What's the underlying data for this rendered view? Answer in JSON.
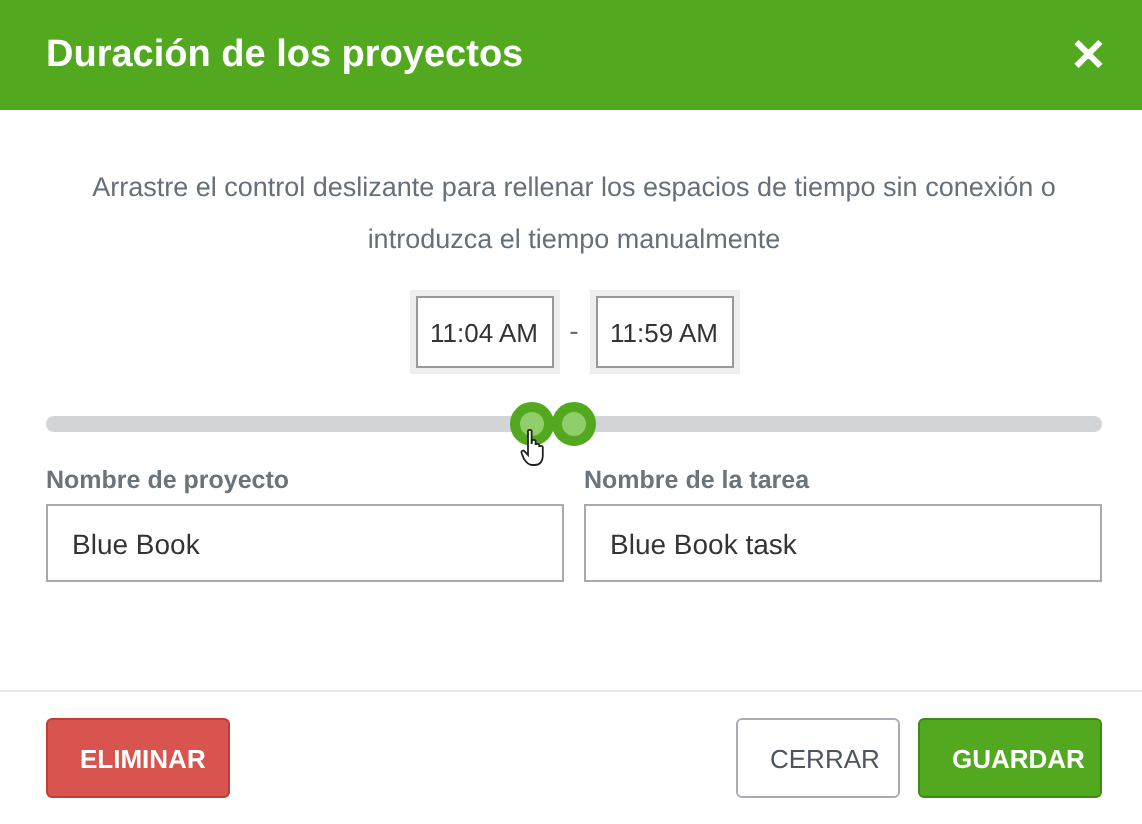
{
  "dialog": {
    "title": "Duración de los proyectos",
    "close": "✕"
  },
  "description": "Arrastre el control deslizante para rellenar los espacios de tiempo sin conexión o introduzca el tiempo manualmente",
  "time_range": {
    "start": "11:04 AM",
    "separator": "-",
    "end": "11:59 AM"
  },
  "slider": {
    "thumbs": [
      {
        "level": 0.46
      },
      {
        "level": 0.5
      }
    ]
  },
  "fields": [
    {
      "label": "Nombre de proyecto",
      "value": "Blue Book"
    },
    {
      "label": "Nombre de la tarea",
      "value": "Blue Book task"
    }
  ],
  "buttons": [
    {
      "label": "ELIMINAR",
      "kind": "danger"
    },
    {
      "label": "CERRAR",
      "kind": "plain"
    },
    {
      "label": "GUARDAR",
      "kind": "primary"
    }
  ]
}
